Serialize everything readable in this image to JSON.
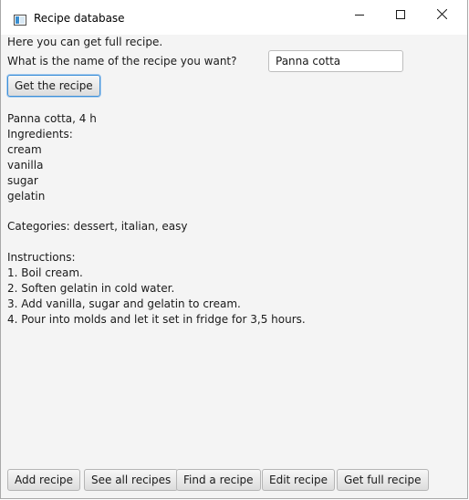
{
  "window": {
    "title": "Recipe database",
    "icon": "java-app-icon",
    "controls": [
      "minimize-icon",
      "maximize-icon",
      "close-icon"
    ]
  },
  "main": {
    "intro": "Here you can get full recipe.",
    "question": "What is the name of the recipe you want?",
    "recipe_name_input": {
      "value": "Panna cotta",
      "placeholder": ""
    },
    "get_button_label": "Get the recipe",
    "output_lines": [
      "Panna cotta, 4 h",
      "Ingredients:",
      "cream",
      "vanilla",
      "sugar",
      "gelatin",
      "",
      "Categories: dessert, italian, easy",
      "",
      "Instructions:",
      "1. Boil cream.",
      "2. Soften gelatin in cold water.",
      "3. Add vanilla, sugar and gelatin to cream.",
      "4. Pour into molds and let it set in fridge for 3,5 hours."
    ]
  },
  "bottom_bar": {
    "buttons": [
      {
        "label": "Add recipe"
      },
      {
        "label": "See all recipes"
      },
      {
        "label": "Find a recipe"
      },
      {
        "label": "Edit recipe"
      },
      {
        "label": "Get full recipe"
      }
    ]
  },
  "colors": {
    "background": "#f4f4f4",
    "focus_border": "#3c8fd8"
  }
}
